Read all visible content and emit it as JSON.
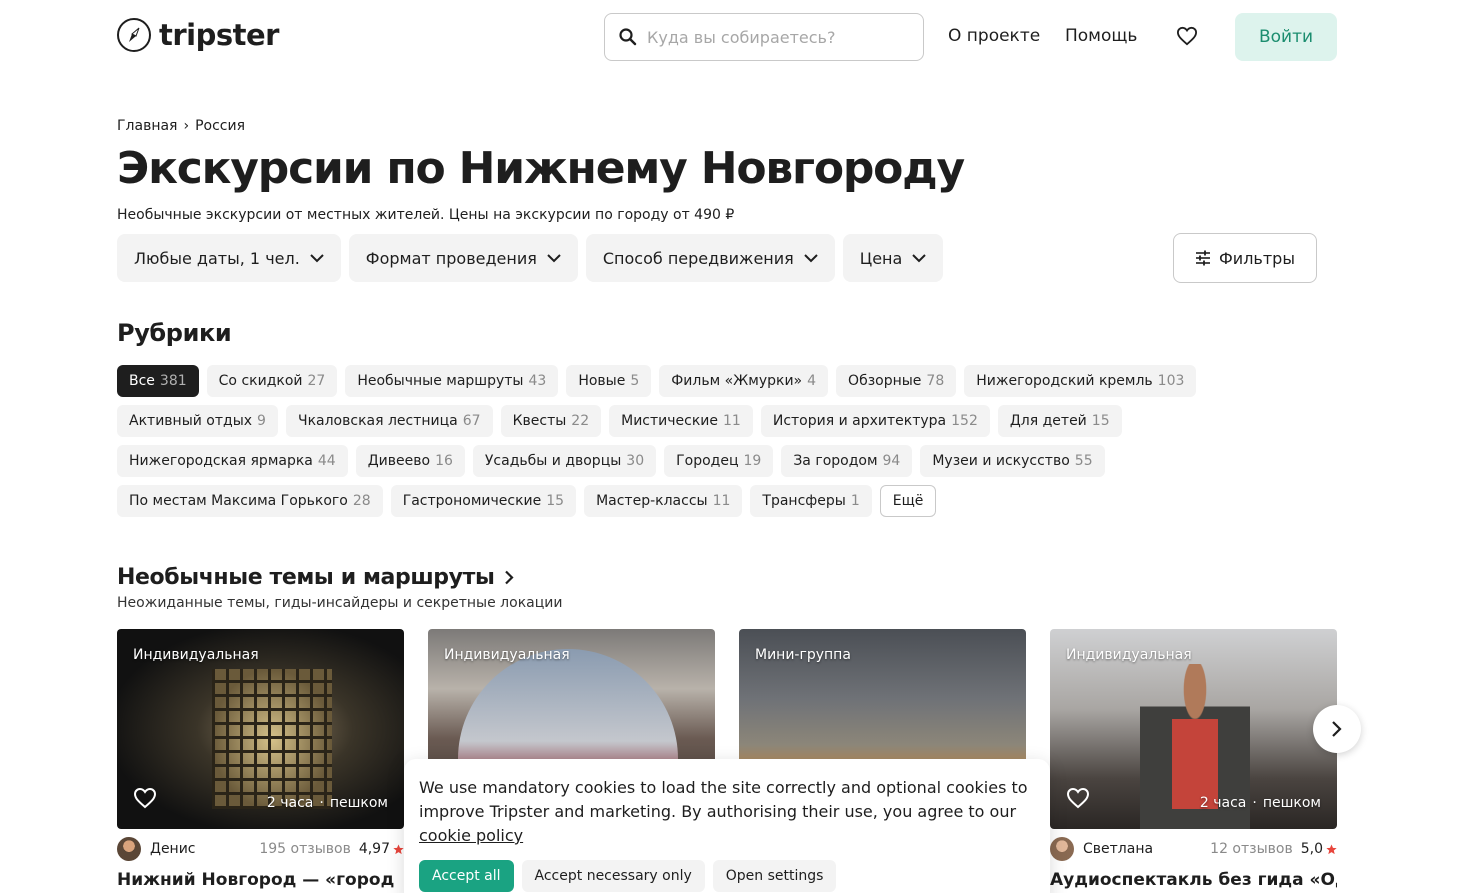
{
  "header": {
    "logo_text": "tripster",
    "search_placeholder": "Куда вы собираетесь?",
    "nav_about": "О проекте",
    "nav_help": "Помощь",
    "login_label": "Войти"
  },
  "breadcrumb": {
    "home": "Главная",
    "separator": "›",
    "current": "Россия"
  },
  "page": {
    "title": "Экскурсии по Нижнему Новгороду",
    "subtitle": "Необычные экскурсии от местных жителей. Цены на экскурсии по городу от 490 ₽"
  },
  "filters": {
    "dates": "Любые даты, 1 чел.",
    "format": "Формат проведения",
    "transport": "Способ передвижения",
    "price": "Цена",
    "more": "Фильтры"
  },
  "rubrics": {
    "title": "Рубрики",
    "rows": [
      [
        {
          "label": "Все",
          "count": "381"
        },
        {
          "label": "Со скидкой",
          "count": "27"
        },
        {
          "label": "Необычные маршруты",
          "count": "43"
        },
        {
          "label": "Новые",
          "count": "5"
        },
        {
          "label": "Фильм «Жмурки»",
          "count": "4"
        },
        {
          "label": "Обзорные",
          "count": "78"
        },
        {
          "label": "Нижегородский кремль",
          "count": "103"
        }
      ],
      [
        {
          "label": "Активный отдых",
          "count": "9"
        },
        {
          "label": "Чкаловская лестница",
          "count": "67"
        },
        {
          "label": "Квесты",
          "count": "22"
        },
        {
          "label": "Мистические",
          "count": "11"
        },
        {
          "label": "История и архитектура",
          "count": "152"
        },
        {
          "label": "Для детей",
          "count": "15"
        }
      ],
      [
        {
          "label": "Нижегородская ярмарка",
          "count": "44"
        },
        {
          "label": "Дивеево",
          "count": "16"
        },
        {
          "label": "Усадьбы и дворцы",
          "count": "30"
        },
        {
          "label": "Городец",
          "count": "19"
        },
        {
          "label": "За городом",
          "count": "94"
        },
        {
          "label": "Музеи и искусство",
          "count": "55"
        }
      ],
      [
        {
          "label": "По местам Максима Горького",
          "count": "28"
        },
        {
          "label": "Гастрономические",
          "count": "15"
        },
        {
          "label": "Мастер-классы",
          "count": "11"
        },
        {
          "label": "Трансферы",
          "count": "1"
        }
      ]
    ],
    "more_label": "Ещё"
  },
  "section": {
    "title": "Необычные темы и маршруты",
    "subtitle": "Неожиданные темы, гиды-инсайдеры и секретные локации"
  },
  "cards": [
    {
      "badge": "Индивидуальная",
      "duration": "2 часа",
      "dot": "·",
      "mode": "пешком",
      "guide": "Денис",
      "reviews": "195 отзывов",
      "rating": "4,97",
      "title": "Нижний Новгород — «город"
    },
    {
      "badge": "Индивидуальная"
    },
    {
      "badge": "Мини-группа"
    },
    {
      "badge": "Индивидуальная",
      "duration": "2 часа",
      "dot": "·",
      "mode": "пешком",
      "guide": "Светлана",
      "reviews": "12 отзывов",
      "rating": "5,0",
      "title": "Аудиоспектакль без гида «Один"
    }
  ],
  "cookie": {
    "text": "We use mandatory cookies to load the site correctly and optional cookies to improve Tripster and marketing. By authorising their use, you agree to our",
    "link": "cookie policy",
    "accept_all": "Accept all",
    "accept_necessary": "Accept necessary only",
    "open_settings": "Open settings"
  },
  "colors": {
    "accent": "#1aa382",
    "login_bg": "#ddf3ed",
    "chip_bg": "#f3f3f3",
    "rating_star": "#e8453c"
  }
}
